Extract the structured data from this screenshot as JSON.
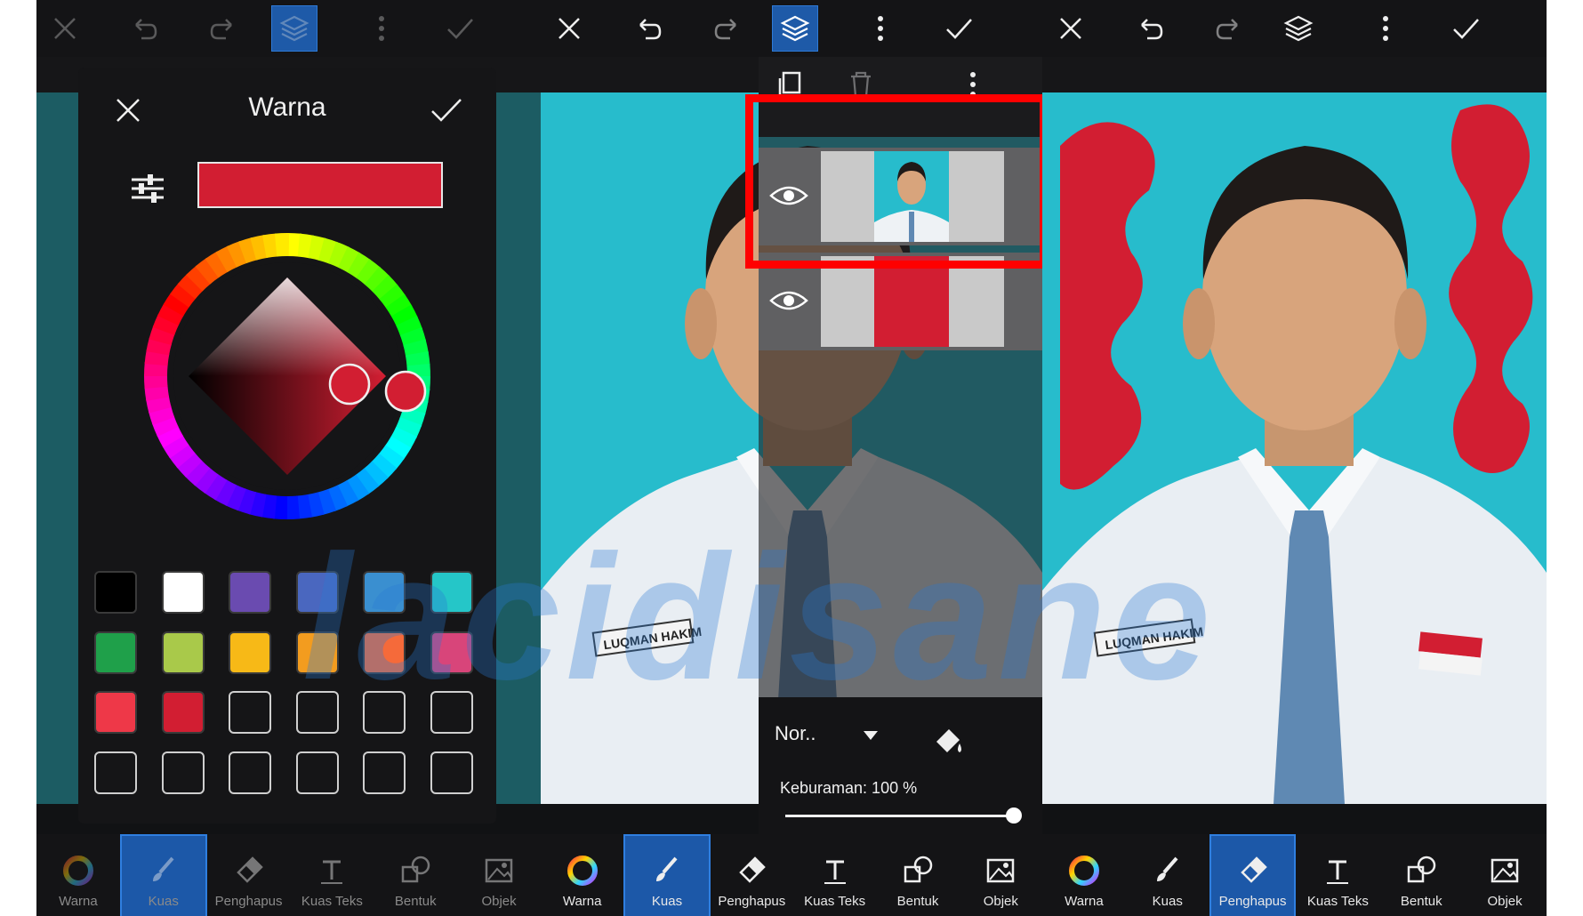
{
  "colors": {
    "accent": "#1c58a8",
    "selected_color": "#d21e32",
    "background_teal": "#27bccc",
    "highlight": "#ff0000"
  },
  "color_dialog": {
    "title": "Warna",
    "swatches": [
      "#000000",
      "#ffffff",
      "#6a4bb0",
      "#4a67bf",
      "#3a8fd0",
      "#25c6c8",
      "#1fa04a",
      "#a9c94a",
      "#f7b917",
      "#f39c1f",
      "#f56a3a",
      "#d8457a",
      "#ee3848",
      "#d21e32"
    ],
    "empty_slots": 10
  },
  "layers_panel": {
    "blend_mode": "Nor..",
    "opacity_label": "Keburaman: 100 %",
    "opacity": 100
  },
  "name_tag": "LUQMAN HAKIM",
  "watermark": "lacidisane",
  "tools": [
    {
      "label": "Warna",
      "icon": "color-wheel-icon"
    },
    {
      "label": "Kuas",
      "icon": "brush-icon"
    },
    {
      "label": "Penghapus",
      "icon": "eraser-icon"
    },
    {
      "label": "Kuas Teks",
      "icon": "text-brush-icon"
    },
    {
      "label": "Bentuk",
      "icon": "shape-icon"
    },
    {
      "label": "Objek",
      "icon": "image-object-icon"
    }
  ],
  "panels": [
    {
      "active_tool": 1,
      "layers_active": true
    },
    {
      "active_tool": 1,
      "layers_active": true
    },
    {
      "active_tool": 2,
      "layers_active": false
    }
  ]
}
